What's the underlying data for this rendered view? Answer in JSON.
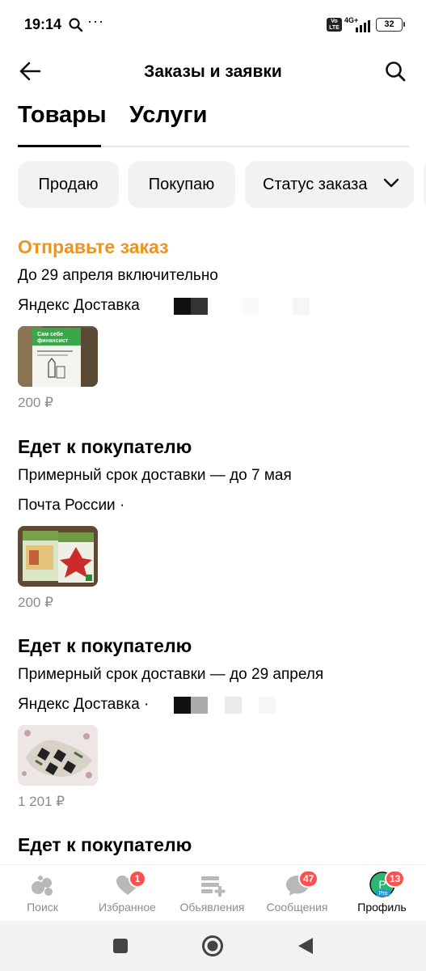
{
  "status_bar": {
    "time": "19:14",
    "dots": "···",
    "volte": "Vo LTE",
    "network": "4G+",
    "battery": "32"
  },
  "header": {
    "title": "Заказы и заявки",
    "back_icon": "arrow-left-icon",
    "search_icon": "search-icon"
  },
  "tabs": [
    {
      "label": "Товары",
      "active": true
    },
    {
      "label": "Услуги",
      "active": false
    }
  ],
  "filters": {
    "sell": "Продаю",
    "buy": "Покупаю",
    "status": "Статус заказа"
  },
  "orders": [
    {
      "status": "Отправьте заказ",
      "status_color": "#f0931e",
      "deadline": "До 29 апреля включительно",
      "carrier": "Яндекс Доставка",
      "thumb_text_1": "Сам себе",
      "thumb_text_2": "финансист",
      "price": "200 ₽"
    },
    {
      "status": "Едет к покупателю",
      "status_color": "#000000",
      "deadline": "Примерный срок доставки — до 7 мая",
      "carrier": "Почта России ·",
      "price": "200 ₽"
    },
    {
      "status": "Едет к покупателю",
      "status_color": "#000000",
      "deadline": "Примерный срок доставки — до 29 апреля",
      "carrier": "Яндекс Доставка ·",
      "price": "1 201 ₽"
    },
    {
      "status": "Едет к покупателю",
      "status_color": "#000000"
    }
  ],
  "bottom_nav": [
    {
      "label": "Поиск",
      "icon": "search-bubbles-icon",
      "badge": null,
      "active": false
    },
    {
      "label": "Избранное",
      "icon": "heart-icon",
      "badge": "1",
      "active": false
    },
    {
      "label": "Обьявления",
      "icon": "listing-add-icon",
      "badge": null,
      "active": false
    },
    {
      "label": "Сообщения",
      "icon": "chat-bubble-icon",
      "badge": "47",
      "active": false
    },
    {
      "label": "Профиль",
      "icon": "profile-avatar-icon",
      "badge": "13",
      "active": true,
      "avatar_letter": "P",
      "avatar_tag": "Pro"
    }
  ],
  "colors": {
    "accent_orange": "#f0931e",
    "badge_red": "#ff4f4f",
    "chip_bg": "#f2f2f2",
    "muted_text": "#8c8c8c"
  }
}
